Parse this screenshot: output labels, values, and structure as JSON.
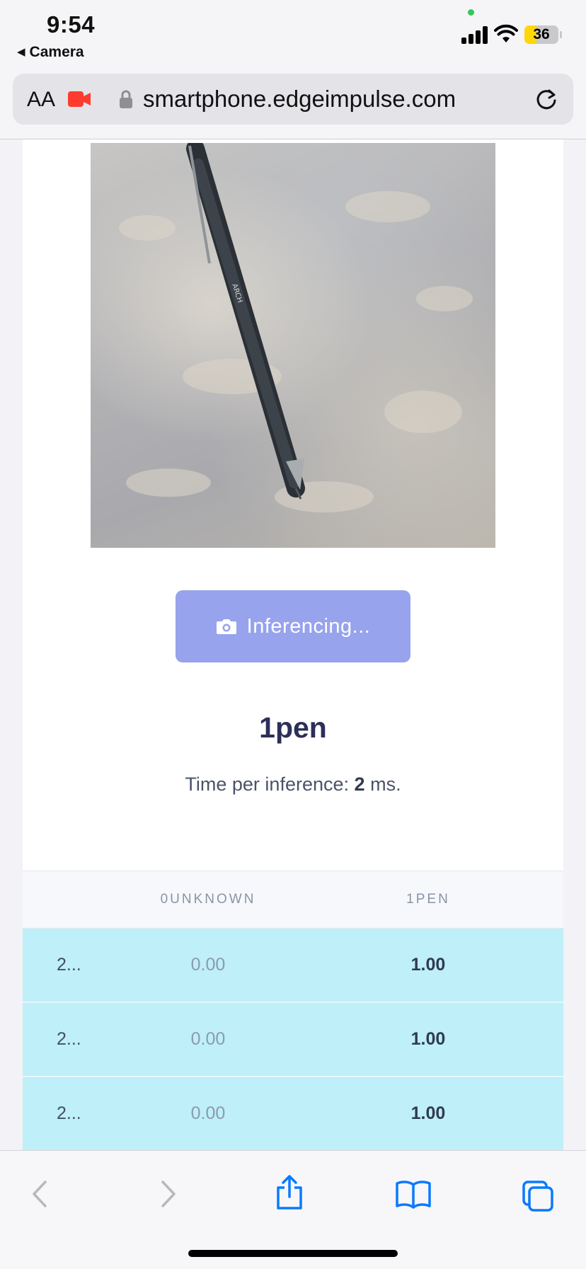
{
  "status_bar": {
    "time": "9:54",
    "back_app": "Camera",
    "battery": "36",
    "battery_level_percent": 36,
    "battery_color": "#ffd60a"
  },
  "browser": {
    "text_size_label": "AA",
    "url": "smartphone.edgeimpulse.com"
  },
  "main": {
    "image_icon": "camera-photo",
    "button_label": "Inferencing...",
    "button_color": "#97a3ec",
    "result_label": "1pen",
    "timing_prefix": "Time per inference:",
    "timing_value": "2",
    "timing_suffix": "ms."
  },
  "table": {
    "columns": [
      "",
      "0UNKNOWN",
      "1PEN"
    ],
    "rows": [
      [
        "2...",
        "0.00",
        "1.00"
      ],
      [
        "2...",
        "0.00",
        "1.00"
      ],
      [
        "2...",
        "0.00",
        "1.00"
      ]
    ],
    "row_color": "#bfeff8"
  },
  "toolbar": {
    "icons": [
      "back-icon",
      "forward-icon",
      "share-icon",
      "bookmarks-icon",
      "tabs-icon"
    ],
    "accent_color": "#0a7aff"
  }
}
